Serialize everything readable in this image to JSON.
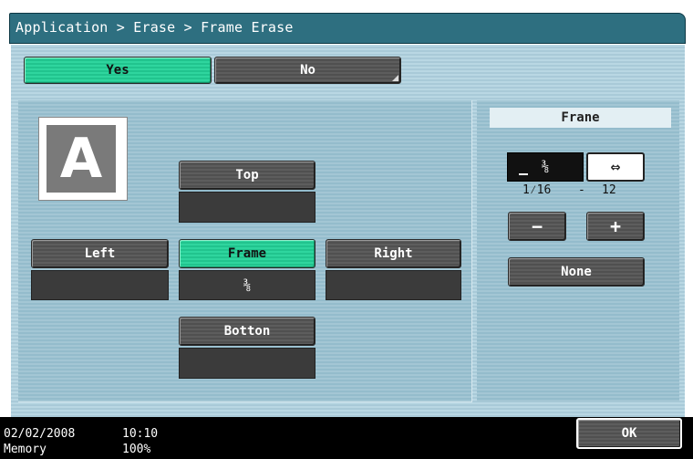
{
  "title": "Application > Erase > Frame Erase",
  "toggle": {
    "yes": "Yes",
    "no": "No"
  },
  "preview": {
    "letter": "A"
  },
  "sides": {
    "top": {
      "label": "Top",
      "value": ""
    },
    "left": {
      "label": "Left",
      "value": ""
    },
    "frame": {
      "label": "Frame",
      "value": "⅜"
    },
    "right": {
      "label": "Right",
      "value": ""
    },
    "bottom": {
      "label": "Botton",
      "value": ""
    }
  },
  "frame_panel": {
    "header": "Frane",
    "value": "⅜",
    "swap_icon": "left-right-arrow",
    "swap_symbol": "⇔",
    "range_min": "1⁄16",
    "range_dash": "-",
    "range_max": "12",
    "minus": "−",
    "plus": "+",
    "none_label": "None"
  },
  "status": {
    "date": "02/02/2008",
    "time": "10:10",
    "memory_label": "Memory",
    "memory_value": "100%"
  },
  "ok_label": "OK",
  "colors": {
    "title_bar": "#2e6f80",
    "selected_green": "#2fd59e",
    "button_gray": "#5d5d5d",
    "panel_blue": "#b9d7e3"
  }
}
